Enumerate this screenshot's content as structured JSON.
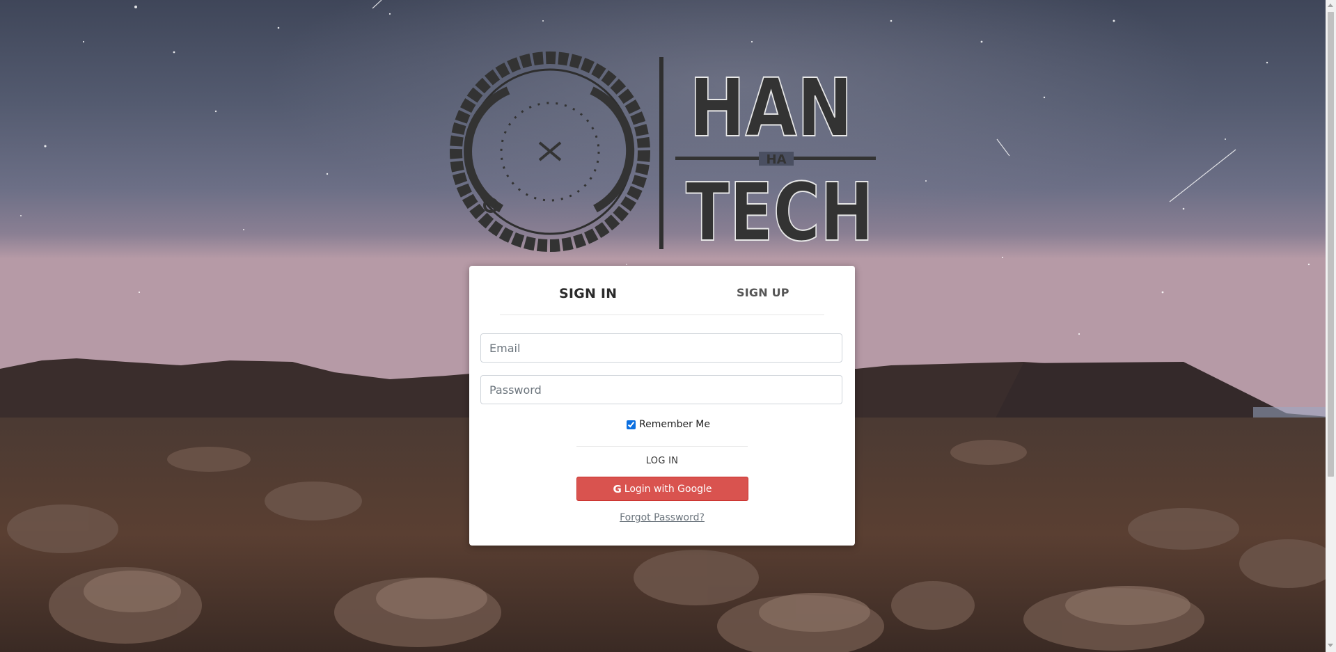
{
  "brand": {
    "logo_line1": "HAN",
    "logo_middle": "HA",
    "logo_line2": "TECH"
  },
  "tabs": {
    "signin_label": "SIGN IN",
    "signup_label": "SIGN UP"
  },
  "form": {
    "email_placeholder": "Email",
    "email_value": "",
    "password_placeholder": "Password",
    "password_value": "",
    "remember_label": "Remember Me",
    "remember_checked": true,
    "login_label": "LOG IN",
    "google_label": "Login with Google",
    "google_icon": "G",
    "forgot_label": "Forgot Password?"
  },
  "colors": {
    "google_button": "#d9534f",
    "card_bg": "#ffffff",
    "logo_fill": "#333333"
  }
}
